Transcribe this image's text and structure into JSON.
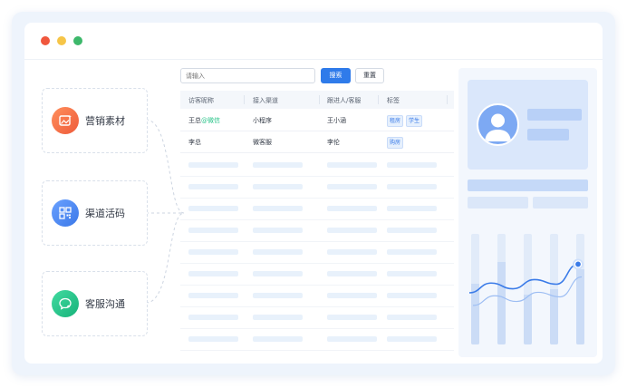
{
  "window": {
    "controls": [
      "close",
      "minimize",
      "maximize"
    ],
    "control_colors": [
      "#f0573d",
      "#f6c548",
      "#3db86b"
    ]
  },
  "channels": [
    {
      "label": "营销素材",
      "icon": "image-sparkle-icon",
      "color": "#f3704c"
    },
    {
      "label": "渠道活码",
      "icon": "qrcode-icon",
      "color": "#4a86ee"
    },
    {
      "label": "客服沟通",
      "icon": "chat-bubble-icon",
      "color": "#2bc48a"
    }
  ],
  "search": {
    "placeholder": "请输入",
    "search_label": "搜索",
    "reset_label": "重置"
  },
  "table": {
    "headers": [
      "访客昵称",
      "接入渠道",
      "跟进人/客服",
      "标签"
    ],
    "rows": [
      {
        "nickname": "王总",
        "source_tag": "@微信",
        "channel": "小程序",
        "agent": "王小涵",
        "tags": [
          "租房",
          "学生"
        ]
      },
      {
        "nickname": "李总",
        "source_tag": "",
        "channel": "微客服",
        "agent": "李伦",
        "tags": [
          "购房"
        ]
      }
    ],
    "placeholder_rows": 9
  },
  "panel": {
    "accent": "#3a7be8",
    "column_levels": [
      0.55,
      0.75,
      0.45,
      0.5,
      0.68
    ],
    "trend": [
      0.35,
      0.52,
      0.42,
      0.58,
      0.5,
      0.85
    ]
  }
}
